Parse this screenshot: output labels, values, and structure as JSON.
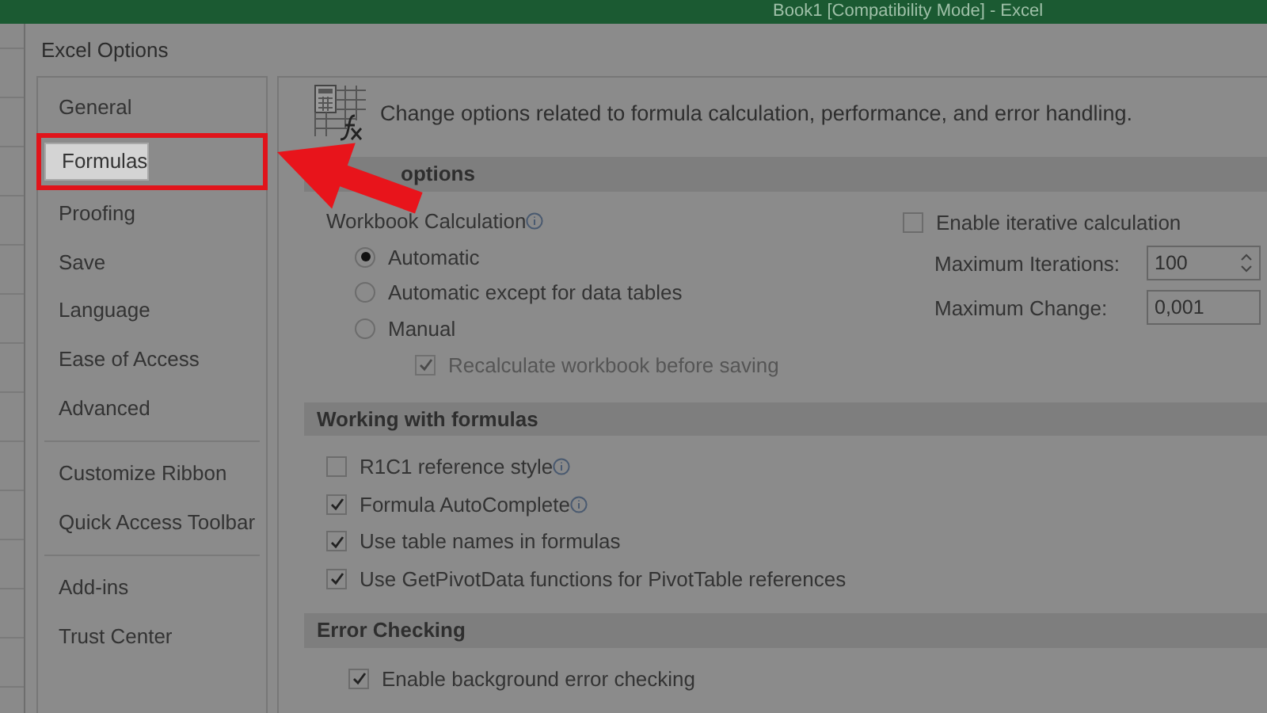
{
  "background_window": {
    "title": "Book1 [Compatibility Mode] - Excel"
  },
  "window": {
    "title": "Excel Options"
  },
  "sidebar": {
    "items": [
      {
        "label": "General",
        "selected": false,
        "highlighted": false,
        "separator_before": false
      },
      {
        "label": "Formulas",
        "selected": true,
        "highlighted": true,
        "separator_before": false
      },
      {
        "label": "Proofing",
        "selected": false,
        "highlighted": false,
        "separator_before": false
      },
      {
        "label": "Save",
        "selected": false,
        "highlighted": false,
        "separator_before": false
      },
      {
        "label": "Language",
        "selected": false,
        "highlighted": false,
        "separator_before": false
      },
      {
        "label": "Ease of Access",
        "selected": false,
        "highlighted": false,
        "separator_before": false
      },
      {
        "label": "Advanced",
        "selected": false,
        "highlighted": false,
        "separator_before": false
      },
      {
        "label": "Customize Ribbon",
        "selected": false,
        "highlighted": false,
        "separator_before": true
      },
      {
        "label": "Quick Access Toolbar",
        "selected": false,
        "highlighted": false,
        "separator_before": false
      },
      {
        "label": "Add-ins",
        "selected": false,
        "highlighted": false,
        "separator_before": true
      },
      {
        "label": "Trust Center",
        "selected": false,
        "highlighted": false,
        "separator_before": false
      }
    ]
  },
  "pointer_arrow": true,
  "header": {
    "text": "Change options related to formula calculation, performance, and error handling."
  },
  "calculation": {
    "title": "options",
    "workbook_label": "Workbook Calculation",
    "info": true,
    "modes": [
      {
        "label": "Automatic",
        "selected": true
      },
      {
        "label": "Automatic except for data tables",
        "selected": false
      },
      {
        "label": "Manual",
        "selected": false
      }
    ],
    "recalc": {
      "label": "Recalculate workbook before saving",
      "checked": true,
      "disabled": true
    },
    "iterative": {
      "label": "Enable iterative calculation",
      "checked": false
    },
    "max_iterations": {
      "label": "Maximum Iterations:",
      "value": "100"
    },
    "max_change": {
      "label": "Maximum Change:",
      "value": "0,001"
    }
  },
  "formulas": {
    "title": "Working with formulas",
    "options": [
      {
        "label": "R1C1 reference style",
        "checked": false,
        "info": true
      },
      {
        "label": "Formula AutoComplete",
        "checked": true,
        "info": true
      },
      {
        "label": "Use table names in formulas",
        "checked": true,
        "info": false
      },
      {
        "label": "Use GetPivotData functions for PivotTable references",
        "checked": true,
        "info": false
      }
    ]
  },
  "error_checking": {
    "title": "Error Checking",
    "options": [
      {
        "label": "Enable background error checking",
        "checked": true
      }
    ]
  }
}
